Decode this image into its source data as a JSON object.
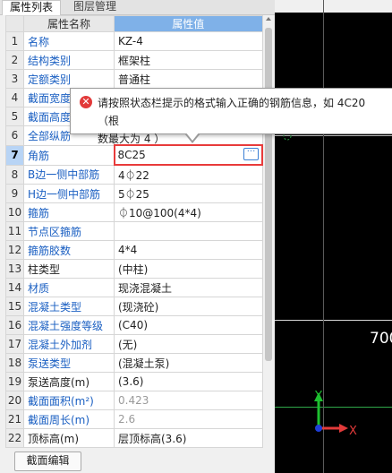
{
  "tabs": {
    "active": "属性列表",
    "inactive": "图层管理"
  },
  "grid": {
    "header": {
      "index": "",
      "name": "属性名称",
      "value": "属性值"
    },
    "rows": [
      {
        "index": "1",
        "name": "名称",
        "value": "KZ-4"
      },
      {
        "index": "2",
        "name": "结构类别",
        "value": "框架柱"
      },
      {
        "index": "3",
        "name": "定额类别",
        "value": "普通柱"
      },
      {
        "index": "4",
        "name": "截面宽度",
        "value": ""
      },
      {
        "index": "5",
        "name": "截面高度",
        "value": ""
      },
      {
        "index": "6",
        "name": "全部纵筋",
        "value": ""
      },
      {
        "index": "7",
        "name": "角筋",
        "value": "8C25"
      },
      {
        "index": "8",
        "name": "B边一侧中部筋",
        "value": "4⏀22"
      },
      {
        "index": "9",
        "name": "H边一侧中部筋",
        "value": "5⏀25"
      },
      {
        "index": "10",
        "name": "箍筋",
        "value": "⏀10@100(4*4)"
      },
      {
        "index": "11",
        "name": "节点区箍筋",
        "value": ""
      },
      {
        "index": "12",
        "name": "箍筋胶数",
        "value": "4*4"
      },
      {
        "index": "13",
        "name": "柱类型",
        "value": "(中柱)"
      },
      {
        "index": "14",
        "name": "材质",
        "value": "现浇混凝土"
      },
      {
        "index": "15",
        "name": "混凝土类型",
        "value": "(现浇砼)"
      },
      {
        "index": "16",
        "name": "混凝土强度等级",
        "value": "(C40)"
      },
      {
        "index": "17",
        "name": "混凝土外加剂",
        "value": "(无)"
      },
      {
        "index": "18",
        "name": "泵送类型",
        "value": "(混凝土泵)"
      },
      {
        "index": "19",
        "name": "泵送高度(m)",
        "value": "(3.6)"
      },
      {
        "index": "20",
        "name": "截面面积(m²)",
        "value": "0.423"
      },
      {
        "index": "21",
        "name": "截面周长(m)",
        "value": "2.6"
      },
      {
        "index": "22",
        "name": "顶标高(m)",
        "value": "层顶标高(3.6)"
      }
    ]
  },
  "tooltip": {
    "message": "请按照状态栏提示的格式输入正确的钢筋信息，如 4C20 （根\n数最大为 4 ）"
  },
  "bottom": {
    "button_label": "截面编辑"
  },
  "canvas": {
    "dimension_text": "700",
    "axis_x": "X",
    "axis_y": "Y"
  },
  "colors": {
    "accent": "#7fb1e8",
    "error": "#e23a3a",
    "name_blue": "#1a5fc2"
  }
}
